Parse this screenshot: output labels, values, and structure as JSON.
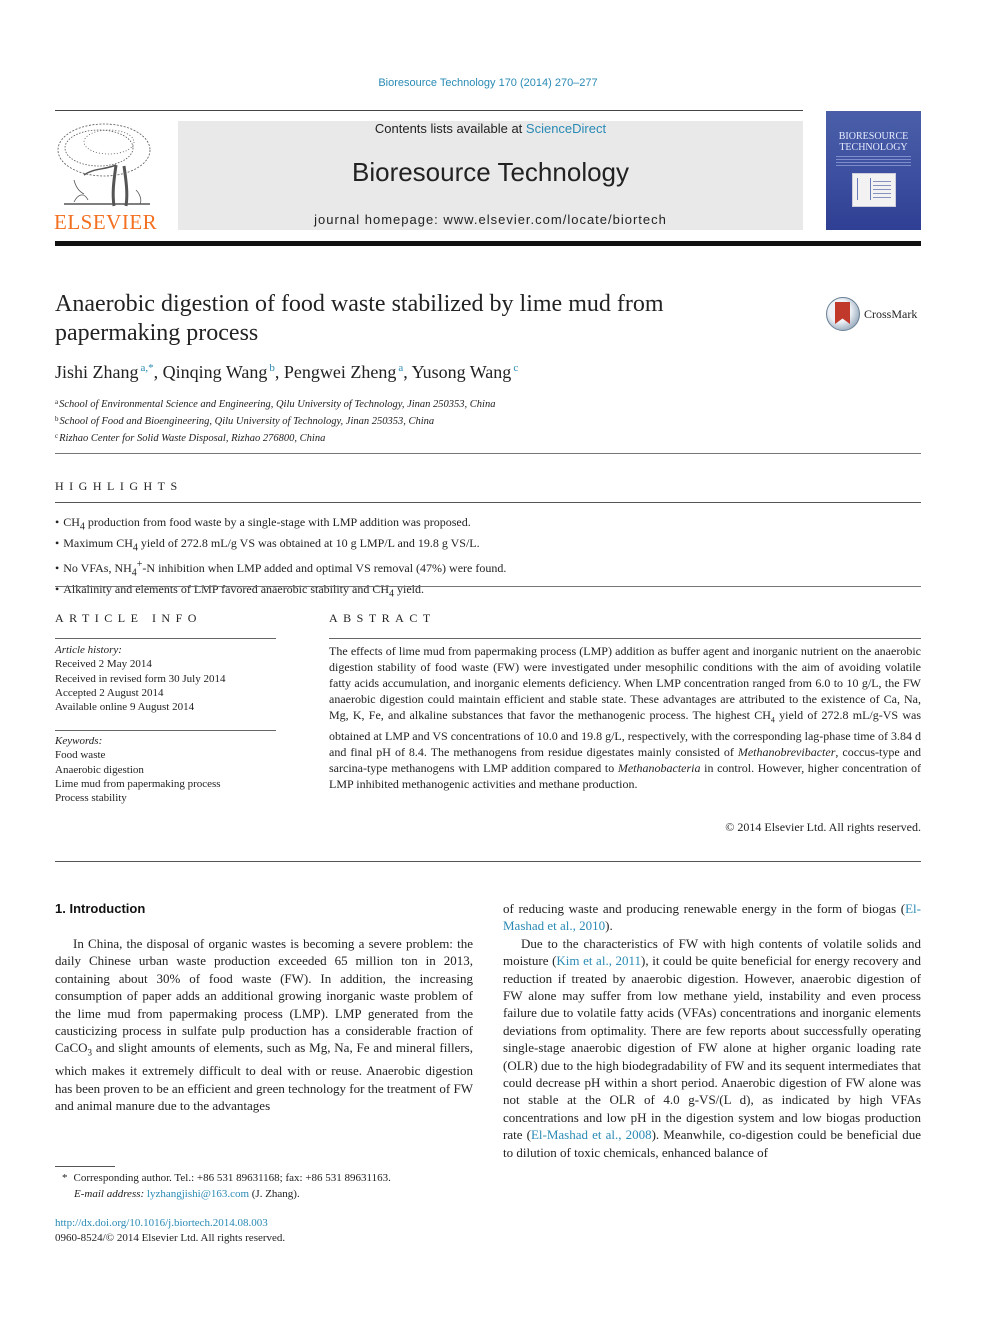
{
  "header": {
    "citation": "Bioresource Technology 170 (2014) 270–277",
    "contents_prefix": "Contents lists available at ",
    "contents_link": "ScienceDirect",
    "journal_name": "Bioresource Technology",
    "homepage": "journal homepage: www.elsevier.com/locate/biortech",
    "publisher_logo_text": "ELSEVIER",
    "cover_title_line1": "BIORESOURCE",
    "cover_title_line2": "TECHNOLOGY",
    "crossmark_label": "CrossMark"
  },
  "article": {
    "title": "Anaerobic digestion of food waste stabilized by lime mud from papermaking process",
    "authors": [
      {
        "name": "Jishi Zhang",
        "affil": "a,*"
      },
      {
        "name": "Qinqing Wang",
        "affil": "b"
      },
      {
        "name": "Pengwei Zheng",
        "affil": "a"
      },
      {
        "name": "Yusong Wang",
        "affil": "c"
      }
    ],
    "affiliations": [
      {
        "mark": "a",
        "text": "School of Environmental Science and Engineering, Qilu University of Technology, Jinan 250353, China"
      },
      {
        "mark": "b",
        "text": "School of Food and Bioengineering, Qilu University of Technology, Jinan 250353, China"
      },
      {
        "mark": "c",
        "text": "Rizhao Center for Solid Waste Disposal, Rizhao 276800, China"
      }
    ]
  },
  "highlights": {
    "heading": "HIGHLIGHTS",
    "items": [
      {
        "pre": "CH",
        "sub": "4",
        "post": " production from food waste by a single-stage with LMP addition was proposed."
      },
      {
        "pre": "Maximum CH",
        "sub": "4",
        "post": " yield of 272.8 mL/g VS was obtained at 10 g LMP/L and 19.8 g VS/L."
      },
      {
        "pre": "No VFAs, NH",
        "sub": "4",
        "sup": "+",
        "post": "-N inhibition when LMP added and optimal VS removal (47%) were found."
      },
      {
        "pre": "Alkalinity and elements of LMP favored anaerobic stability and CH",
        "sub": "4",
        "post": " yield."
      }
    ]
  },
  "article_info": {
    "heading": "ARTICLE INFO",
    "history_label": "Article history:",
    "history": [
      "Received 2 May 2014",
      "Received in revised form 30 July 2014",
      "Accepted 2 August 2014",
      "Available online 9 August 2014"
    ],
    "keywords_label": "Keywords:",
    "keywords": [
      "Food waste",
      "Anaerobic digestion",
      "Lime mud from papermaking process",
      "Process stability"
    ]
  },
  "abstract": {
    "heading": "ABSTRACT",
    "part1": "The effects of lime mud from papermaking process (LMP) addition as buffer agent and inorganic nutrient on the anaerobic digestion stability of food waste (FW) were investigated under mesophilic conditions with the aim of avoiding volatile fatty acids accumulation, and inorganic elements deficiency. When LMP concentration ranged from 6.0 to 10 g/L, the FW anaerobic digestion could maintain efficient and stable state. These advantages are attributed to the existence of Ca, Na, Mg, K, Fe, and alkaline substances that favor the methanogenic process. The highest CH",
    "sub1": "4",
    "part2": " yield of 272.8 mL/g-VS was obtained at LMP and VS concentrations of 10.0 and 19.8 g/L, respectively, with the corresponding lag-phase time of 3.84 d and final pH of 8.4. The methanogens from residue digestates mainly consisted of ",
    "genus1": "Methanobrevibacter",
    "part3": ", coccus-type and sarcina-type methanogens with LMP addition compared to ",
    "genus2": "Methanobacteria",
    "part4": " in control. However, higher concentration of LMP inhibited methanogenic activities and methane production.",
    "copyright": "© 2014 Elsevier Ltd. All rights reserved."
  },
  "body": {
    "section_heading": "1. Introduction",
    "left_p1_a": "In China, the disposal of organic wastes is becoming a severe problem: the daily Chinese urban waste production exceeded 65 million ton in 2013, containing about 30% of food waste (FW). In addition, the increasing consumption of paper adds an additional growing inorganic waste problem of the lime mud from papermaking process (LMP). LMP generated from the causticizing process in sulfate pulp production has a considerable fraction of CaCO",
    "left_p1_sub": "3",
    "left_p1_b": " and slight amounts of elements, such as Mg, Na, Fe and mineral fillers, which makes it extremely difficult to deal with or reuse. Anaerobic digestion has been proven to be an efficient and green technology for the treatment of FW and animal manure due to the advantages",
    "right_p1_a": "of reducing waste and producing renewable energy in the form of biogas (",
    "right_p1_ref": "El-Mashad et al., 2010",
    "right_p1_b": ").",
    "right_p2_a": "Due to the characteristics of FW with high contents of volatile solids and moisture (",
    "right_p2_ref1": "Kim et al., 2011",
    "right_p2_b": "), it could be quite beneficial for energy recovery and reduction if treated by anaerobic digestion. However, anaerobic digestion of FW alone may suffer from low methane yield, instability and even process failure due to volatile fatty acids (VFAs) concentrations and inorganic elements deviations from optimality. There are few reports about successfully operating single-stage anaerobic digestion of FW alone at higher organic loading rate (OLR) due to the high biodegradability of FW and its sequent intermediates that could decrease pH within a short period. Anaerobic digestion of FW alone was not stable at the OLR of 4.0 g-VS/(L d), as indicated by high VFAs concentrations and low pH in the digestion system and low biogas production rate (",
    "right_p2_ref2": "El-Mashad et al., 2008",
    "right_p2_c": "). Meanwhile, co-digestion could be beneficial due to dilution of toxic chemicals, enhanced balance of"
  },
  "footnotes": {
    "corresponding": "Corresponding author. Tel.: +86 531 89631168; fax: +86 531 89631163.",
    "corresponding_mark": "*",
    "email_label": "E-mail address:",
    "email": "lyzhangjishi@163.com",
    "email_suffix": " (J. Zhang).",
    "doi": "http://dx.doi.org/10.1016/j.biortech.2014.08.003",
    "issn_copyright": "0960-8524/© 2014 Elsevier Ltd. All rights reserved."
  },
  "colors": {
    "link": "#2a8ab5",
    "elsevier_orange": "#f37021",
    "masthead_bg": "#e9e9e9",
    "cover_blue": "#3c4fa0"
  }
}
